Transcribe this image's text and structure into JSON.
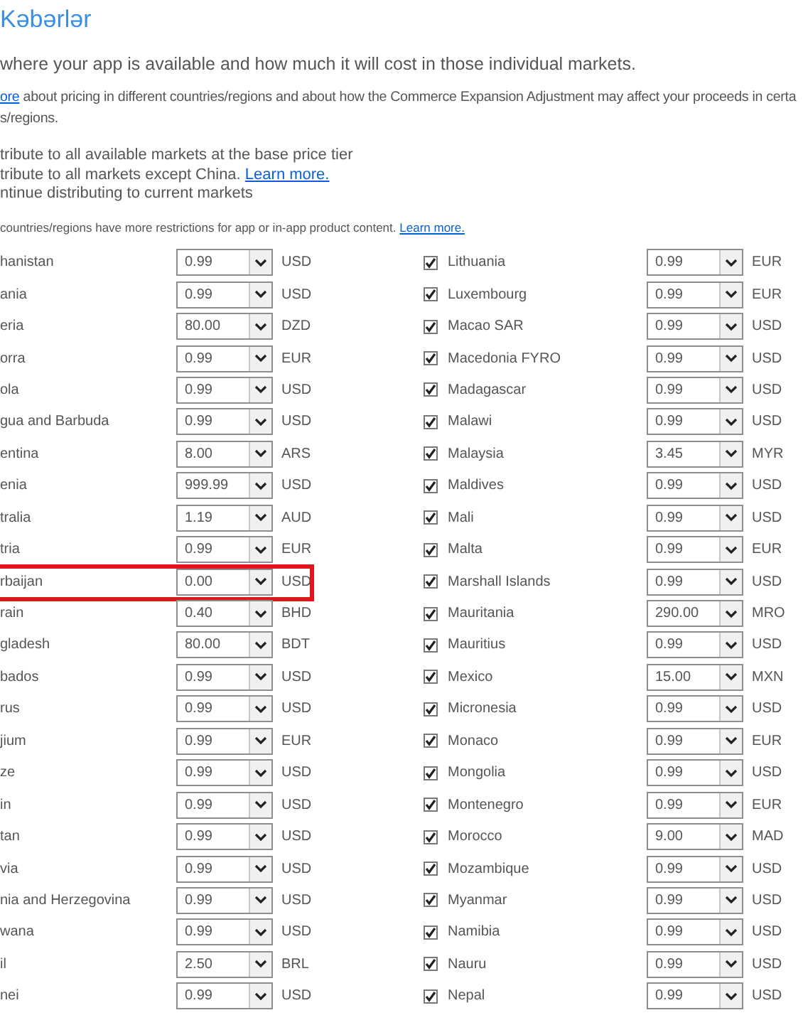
{
  "title": "Kəbərlər",
  "intro": "where your app is available and how much it will cost in those individual markets.",
  "pricing_note": {
    "link": "ore",
    "line_1": "about pricing in different countries/regions and about how the Commerce Expansion Adjustment may affect your proceeds in certa",
    "line_2": "s/regions."
  },
  "options": [
    {
      "text": "tribute to all available markets at the base price tier"
    },
    {
      "text": "tribute to all markets except China.",
      "link": "Learn more."
    },
    {
      "text": "ntinue distributing to current markets"
    }
  ],
  "restriction_note": {
    "text": "countries/regions have more restrictions for app or in-app product content.",
    "link": "Learn more."
  },
  "left_markets": [
    {
      "name": "hanistan",
      "price": "0.99",
      "currency": "USD",
      "highlighted": false
    },
    {
      "name": "ania",
      "price": "0.99",
      "currency": "USD",
      "highlighted": false
    },
    {
      "name": "eria",
      "price": "80.00",
      "currency": "DZD",
      "highlighted": false
    },
    {
      "name": "orra",
      "price": "0.99",
      "currency": "EUR",
      "highlighted": false
    },
    {
      "name": "ola",
      "price": "0.99",
      "currency": "USD",
      "highlighted": false
    },
    {
      "name": "gua and Barbuda",
      "price": "0.99",
      "currency": "USD",
      "highlighted": false
    },
    {
      "name": "entina",
      "price": "8.00",
      "currency": "ARS",
      "highlighted": false
    },
    {
      "name": "enia",
      "price": "999.99",
      "currency": "USD",
      "highlighted": false
    },
    {
      "name": "tralia",
      "price": "1.19",
      "currency": "AUD",
      "highlighted": false
    },
    {
      "name": "tria",
      "price": "0.99",
      "currency": "EUR",
      "highlighted": false
    },
    {
      "name": "rbaijan",
      "price": "0.00",
      "currency": "USD",
      "highlighted": true
    },
    {
      "name": "rain",
      "price": "0.40",
      "currency": "BHD",
      "highlighted": false
    },
    {
      "name": "gladesh",
      "price": "80.00",
      "currency": "BDT",
      "highlighted": false
    },
    {
      "name": "bados",
      "price": "0.99",
      "currency": "USD",
      "highlighted": false
    },
    {
      "name": "rus",
      "price": "0.99",
      "currency": "USD",
      "highlighted": false
    },
    {
      "name": "jium",
      "price": "0.99",
      "currency": "EUR",
      "highlighted": false
    },
    {
      "name": "ze",
      "price": "0.99",
      "currency": "USD",
      "highlighted": false
    },
    {
      "name": "in",
      "price": "0.99",
      "currency": "USD",
      "highlighted": false
    },
    {
      "name": "tan",
      "price": "0.99",
      "currency": "USD",
      "highlighted": false
    },
    {
      "name": "via",
      "price": "0.99",
      "currency": "USD",
      "highlighted": false
    },
    {
      "name": "nia and Herzegovina",
      "price": "0.99",
      "currency": "USD",
      "highlighted": false
    },
    {
      "name": "wana",
      "price": "0.99",
      "currency": "USD",
      "highlighted": false
    },
    {
      "name": "il",
      "price": "2.50",
      "currency": "BRL",
      "highlighted": false
    },
    {
      "name": "nei",
      "price": "0.99",
      "currency": "USD",
      "highlighted": false
    }
  ],
  "right_markets": [
    {
      "name": "Lithuania",
      "checked": true,
      "price": "0.99",
      "currency": "EUR"
    },
    {
      "name": "Luxembourg",
      "checked": true,
      "price": "0.99",
      "currency": "EUR"
    },
    {
      "name": "Macao SAR",
      "checked": true,
      "price": "0.99",
      "currency": "USD"
    },
    {
      "name": "Macedonia FYRO",
      "checked": true,
      "price": "0.99",
      "currency": "USD"
    },
    {
      "name": "Madagascar",
      "checked": true,
      "price": "0.99",
      "currency": "USD"
    },
    {
      "name": "Malawi",
      "checked": true,
      "price": "0.99",
      "currency": "USD"
    },
    {
      "name": "Malaysia",
      "checked": true,
      "price": "3.45",
      "currency": "MYR"
    },
    {
      "name": "Maldives",
      "checked": true,
      "price": "0.99",
      "currency": "USD"
    },
    {
      "name": "Mali",
      "checked": true,
      "price": "0.99",
      "currency": "USD"
    },
    {
      "name": "Malta",
      "checked": true,
      "price": "0.99",
      "currency": "EUR"
    },
    {
      "name": "Marshall Islands",
      "checked": true,
      "price": "0.99",
      "currency": "USD"
    },
    {
      "name": "Mauritania",
      "checked": true,
      "price": "290.00",
      "currency": "MRO"
    },
    {
      "name": "Mauritius",
      "checked": true,
      "price": "0.99",
      "currency": "USD"
    },
    {
      "name": "Mexico",
      "checked": true,
      "price": "15.00",
      "currency": "MXN"
    },
    {
      "name": "Micronesia",
      "checked": true,
      "price": "0.99",
      "currency": "USD"
    },
    {
      "name": "Monaco",
      "checked": true,
      "price": "0.99",
      "currency": "EUR"
    },
    {
      "name": "Mongolia",
      "checked": true,
      "price": "0.99",
      "currency": "USD"
    },
    {
      "name": "Montenegro",
      "checked": true,
      "price": "0.99",
      "currency": "EUR"
    },
    {
      "name": "Morocco",
      "checked": true,
      "price": "9.00",
      "currency": "MAD"
    },
    {
      "name": "Mozambique",
      "checked": true,
      "price": "0.99",
      "currency": "USD"
    },
    {
      "name": "Myanmar",
      "checked": true,
      "price": "0.99",
      "currency": "USD"
    },
    {
      "name": "Namibia",
      "checked": true,
      "price": "0.99",
      "currency": "USD"
    },
    {
      "name": "Nauru",
      "checked": true,
      "price": "0.99",
      "currency": "USD"
    },
    {
      "name": "Nepal",
      "checked": true,
      "price": "0.99",
      "currency": "USD"
    }
  ]
}
